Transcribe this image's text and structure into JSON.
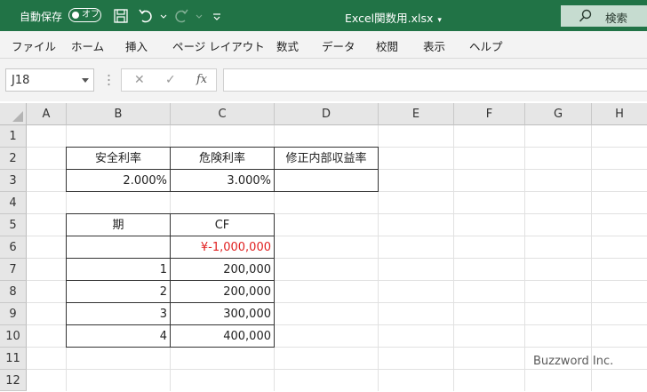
{
  "titlebar": {
    "autosave_label": "自動保存",
    "autosave_state": "オフ",
    "filename": "Excel関数用.xlsx",
    "search_label": "検索",
    "accent": "#217346"
  },
  "menu": [
    "ファイル",
    "ホーム",
    "挿入",
    "ページ レイアウト",
    "数式",
    "データ",
    "校閲",
    "表示",
    "ヘルプ"
  ],
  "formula_bar": {
    "name_box": "J18",
    "fx_label": "fx",
    "formula": ""
  },
  "columns": [
    "A",
    "B",
    "C",
    "D",
    "E",
    "F",
    "G",
    "H"
  ],
  "rows": [
    "1",
    "2",
    "3",
    "4",
    "5",
    "6",
    "7",
    "8",
    "9",
    "10",
    "11",
    "12"
  ],
  "table1": {
    "headers": [
      "安全利率",
      "危険利率",
      "修正内部収益率"
    ],
    "values": [
      "2.000%",
      "3.000%",
      ""
    ]
  },
  "table2": {
    "headers": [
      "期",
      "CF"
    ],
    "rows": [
      {
        "period": "",
        "cf": "¥-1,000,000"
      },
      {
        "period": "1",
        "cf": "200,000"
      },
      {
        "period": "2",
        "cf": "200,000"
      },
      {
        "period": "3",
        "cf": "300,000"
      },
      {
        "period": "4",
        "cf": "400,000"
      }
    ]
  },
  "watermark": "Buzzword Inc."
}
